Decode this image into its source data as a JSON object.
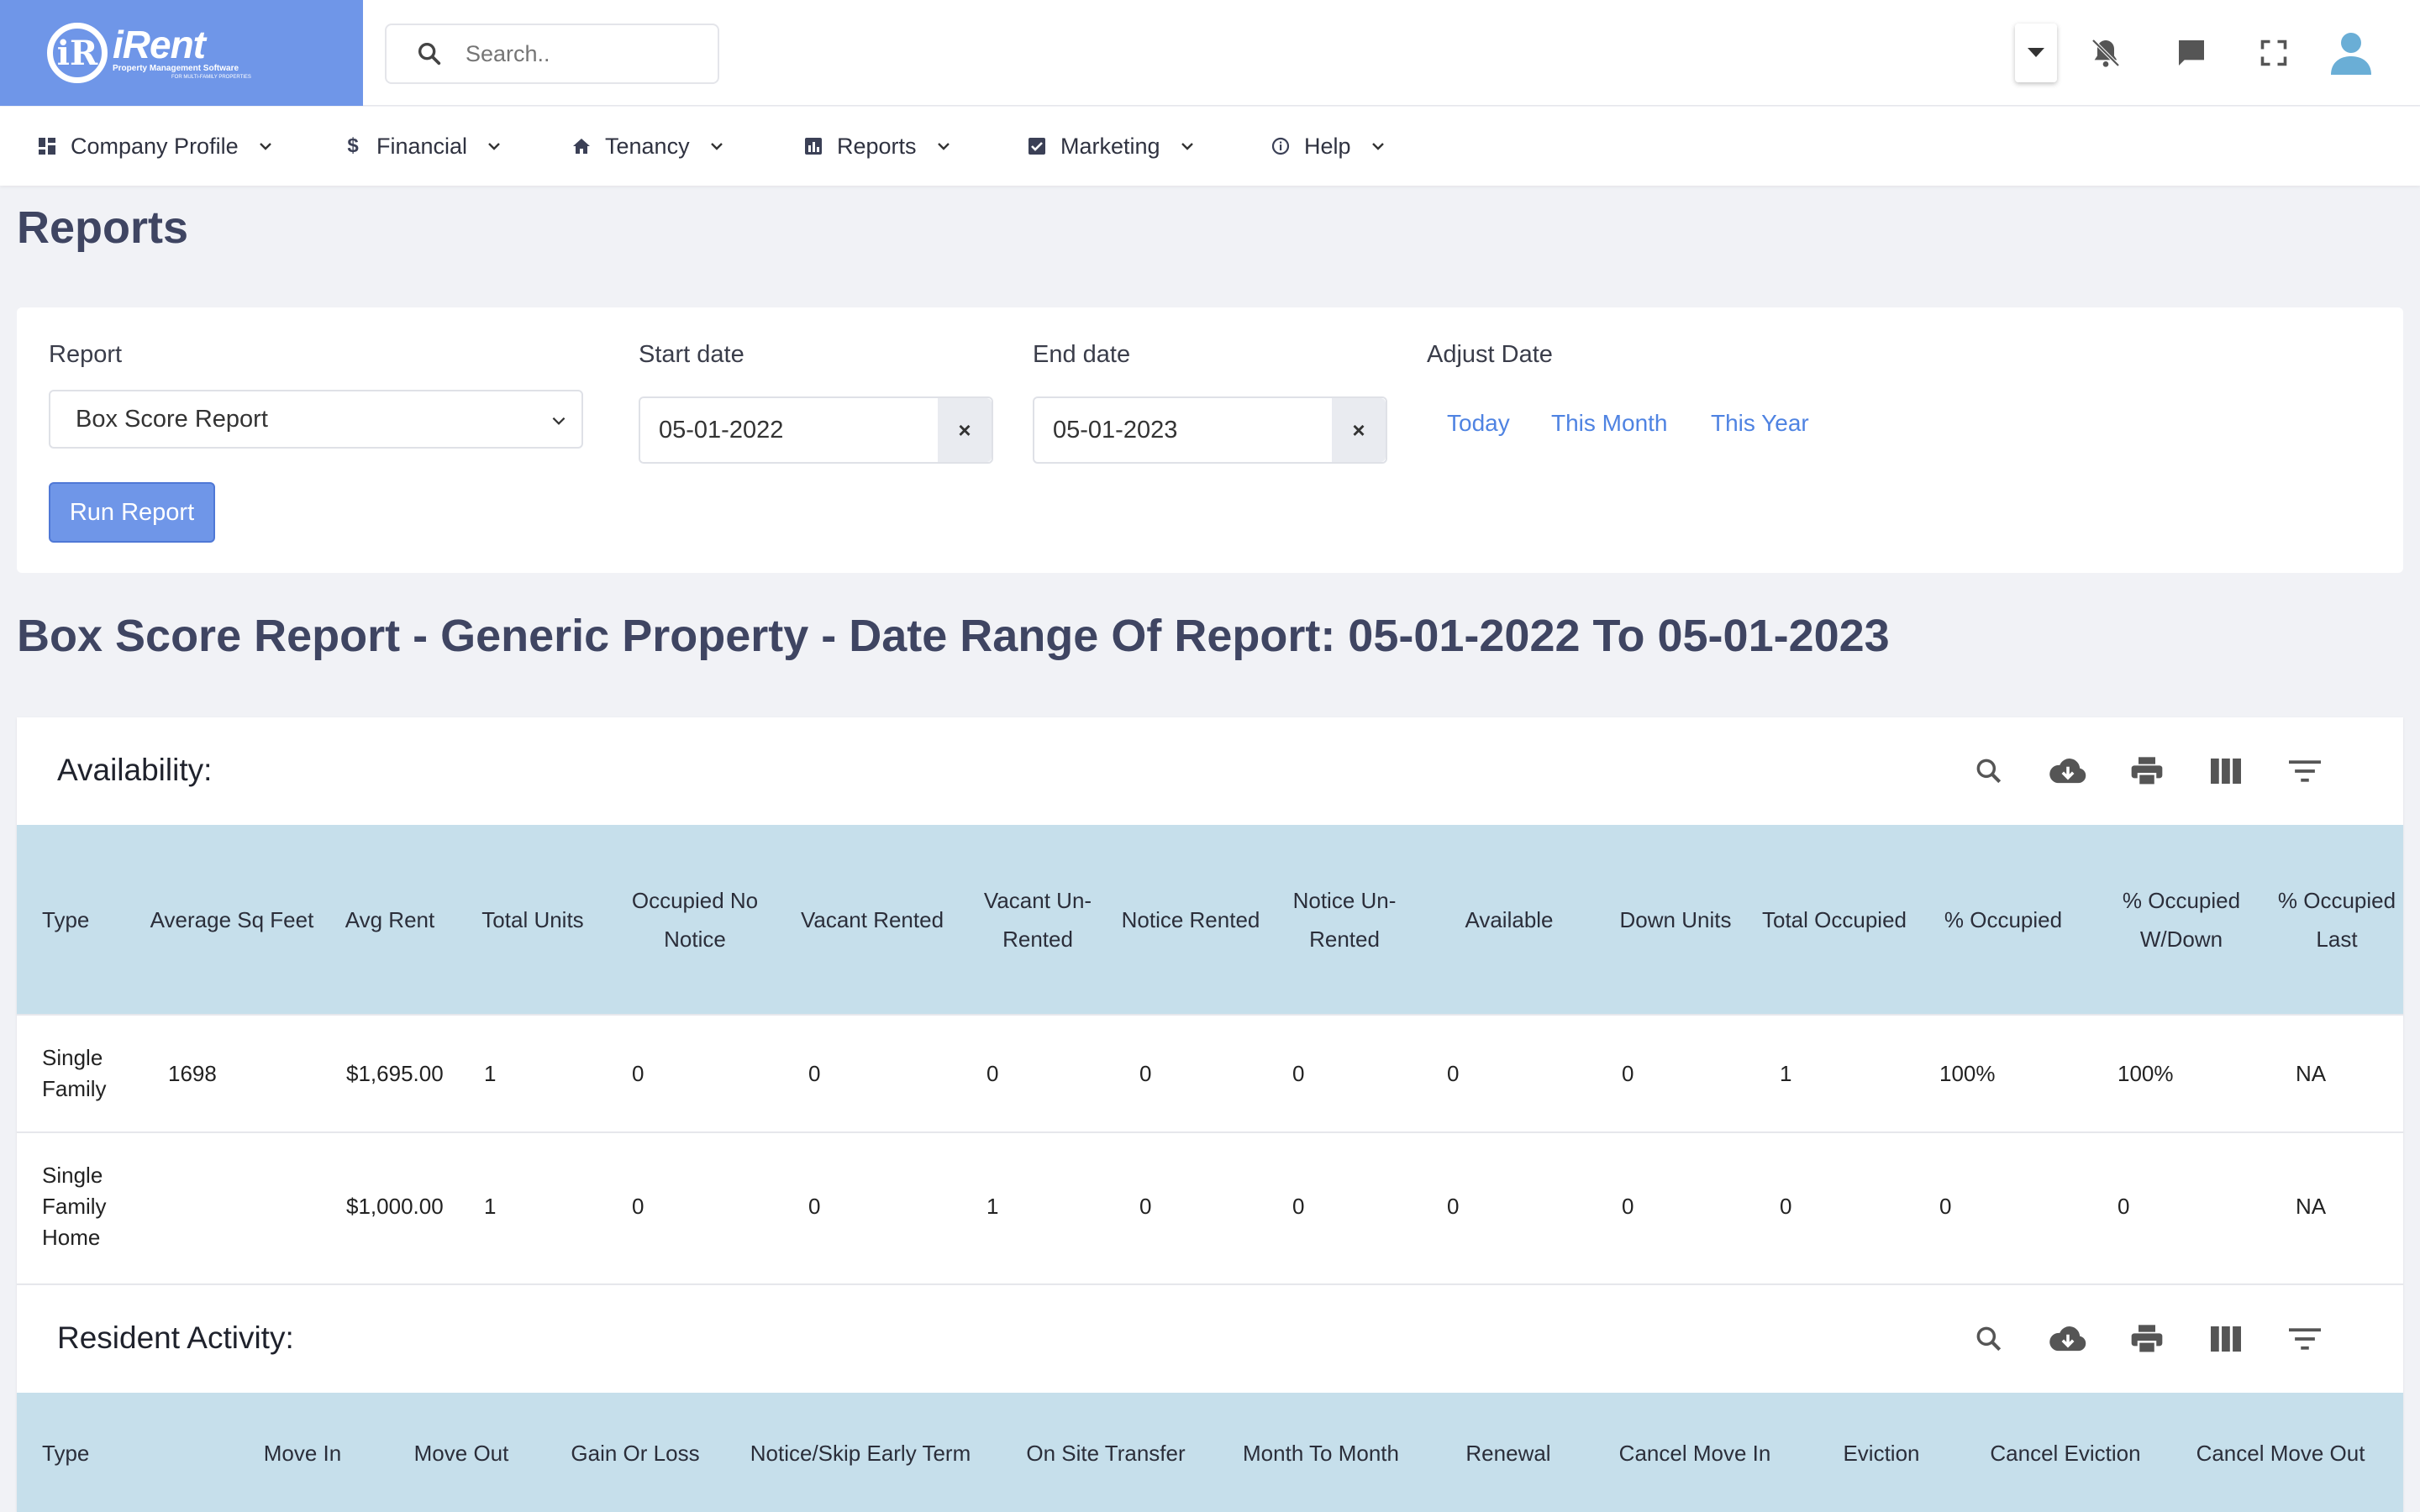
{
  "logo": {
    "mark": "iR",
    "name": "iRent",
    "tagline": "Property Management Software",
    "tagline2": "FOR MULTI-FAMILY PROPERTIES"
  },
  "search": {
    "placeholder": "Search.."
  },
  "topbar_icons": [
    "chevron-down-icon",
    "bell-off-icon",
    "chat-icon",
    "fullscreen-icon",
    "user-avatar-icon"
  ],
  "nav": [
    {
      "label": "Company Profile",
      "icon": "dashboard-icon"
    },
    {
      "label": "Financial",
      "icon": "dollar-icon"
    },
    {
      "label": "Tenancy",
      "icon": "home-icon"
    },
    {
      "label": "Reports",
      "icon": "bar-chart-icon"
    },
    {
      "label": "Marketing",
      "icon": "checkbox-icon"
    },
    {
      "label": "Help",
      "icon": "info-icon"
    }
  ],
  "page_title": "Reports",
  "filters": {
    "report_label": "Report",
    "report_value": "Box Score Report",
    "start_label": "Start date",
    "start_value": "05-01-2022",
    "end_label": "End date",
    "end_value": "05-01-2023",
    "clear": "×",
    "adjust_label": "Adjust Date",
    "adjust_links": [
      "Today",
      "This Month",
      "This Year"
    ],
    "run_button": "Run Report"
  },
  "report_heading": "Box Score Report - Generic Property - Date Range Of Report: 05-01-2022 To 05-01-2023",
  "availability": {
    "title": "Availability:",
    "columns": [
      "Type",
      "Average Sq Feet",
      "Avg Rent",
      "Total Units",
      "Occupied No Notice",
      "Vacant Rented",
      "Vacant Un-Rented",
      "Notice Rented",
      "Notice Un-Rented",
      "Available",
      "Down Units",
      "Total Occupied",
      "% Occupied",
      "% Occupied W/Down",
      "% Occupied Last"
    ],
    "rows": [
      [
        "Single Family",
        "1698",
        "$1,695.00",
        "1",
        "0",
        "0",
        "0",
        "0",
        "0",
        "0",
        "0",
        "1",
        "100%",
        "100%",
        "NA"
      ],
      [
        "Single Family Home",
        "",
        "$1,000.00",
        "1",
        "0",
        "0",
        "1",
        "0",
        "0",
        "0",
        "0",
        "0",
        "0",
        "0",
        "NA"
      ]
    ]
  },
  "resident_activity": {
    "title": "Resident Activity:",
    "columns": [
      "Type",
      "Move In",
      "Move Out",
      "Gain Or Loss",
      "Notice/Skip Early Term",
      "On Site Transfer",
      "Month To Month",
      "Renewal",
      "Cancel Move In",
      "Eviction",
      "Cancel Eviction",
      "Cancel Move Out"
    ]
  },
  "toolbar_icons": [
    "search-icon",
    "cloud-download-icon",
    "print-icon",
    "columns-icon",
    "filter-icon"
  ],
  "colors": {
    "brand": "#6f96e8",
    "header_row": "#c6dfeb",
    "link": "#4f83e2",
    "heading": "#3f4562"
  }
}
